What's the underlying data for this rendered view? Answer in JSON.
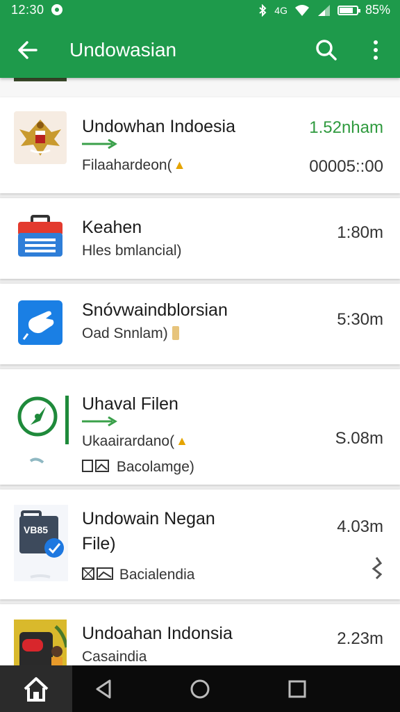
{
  "status_bar": {
    "time": "12:30",
    "bluetooth_icon": "bluetooth-icon",
    "data_label": "4G",
    "battery_level": 0.85,
    "battery_text": "85%"
  },
  "toolbar": {
    "title": "Undowasian",
    "back_icon": "arrow-back-icon",
    "search_icon": "search-icon",
    "more_icon": "more-vert-icon",
    "color": "#1e9a4b"
  },
  "items": [
    {
      "name": "Undowhan Indoesia",
      "subtitle": "Filaahardeon(",
      "meta_top": "1.52nham",
      "meta_bottom": "00005::00",
      "icon": "garuda-emblem-icon"
    },
    {
      "name": "Keahen",
      "subtitle": "Hles bmlancial)",
      "meta": "1:80m",
      "icon": "briefcase-icon"
    },
    {
      "name": "Snóvwaindblorsian",
      "subtitle": "Oad Snnlam)",
      "meta": "5:30m",
      "icon": "hand-app-icon"
    },
    {
      "name": "Uhaval Filen",
      "subtitle": "Ukaairardano(",
      "detail": "Bacolamge)",
      "meta": "S.08m",
      "icon": "compass-icon"
    },
    {
      "name_line1": "Undowain Negan",
      "name_line2": "File)",
      "detail": "Bacialendia",
      "meta": "4.03m",
      "badge_text": "VB85",
      "icon": "document-share-icon"
    },
    {
      "name": "Undoahan Indonsia",
      "subtitle": "Casaindia",
      "meta": "2.23m",
      "icon": "photo-thumbnail-icon"
    }
  ],
  "nav": {
    "home_icon": "home-icon",
    "back_icon": "nav-back-icon",
    "home_circle_icon": "nav-home-circle-icon",
    "recents_icon": "nav-recents-icon"
  }
}
